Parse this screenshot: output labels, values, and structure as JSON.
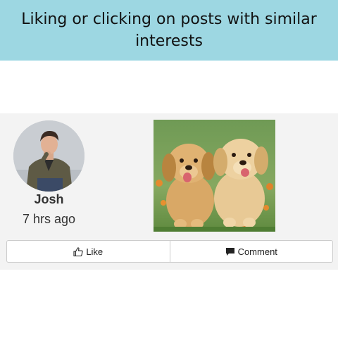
{
  "banner": {
    "title": "Liking or clicking on posts with similar interests",
    "color": "#9dd7e2"
  },
  "post": {
    "user": {
      "name": "Josh",
      "avatar_icon": "user-avatar"
    },
    "timestamp": "7 hrs ago",
    "image": "puppies-photo",
    "actions": [
      {
        "label": "Like",
        "icon": "thumbs-up-icon"
      },
      {
        "label": "Comment",
        "icon": "comment-icon"
      }
    ]
  }
}
